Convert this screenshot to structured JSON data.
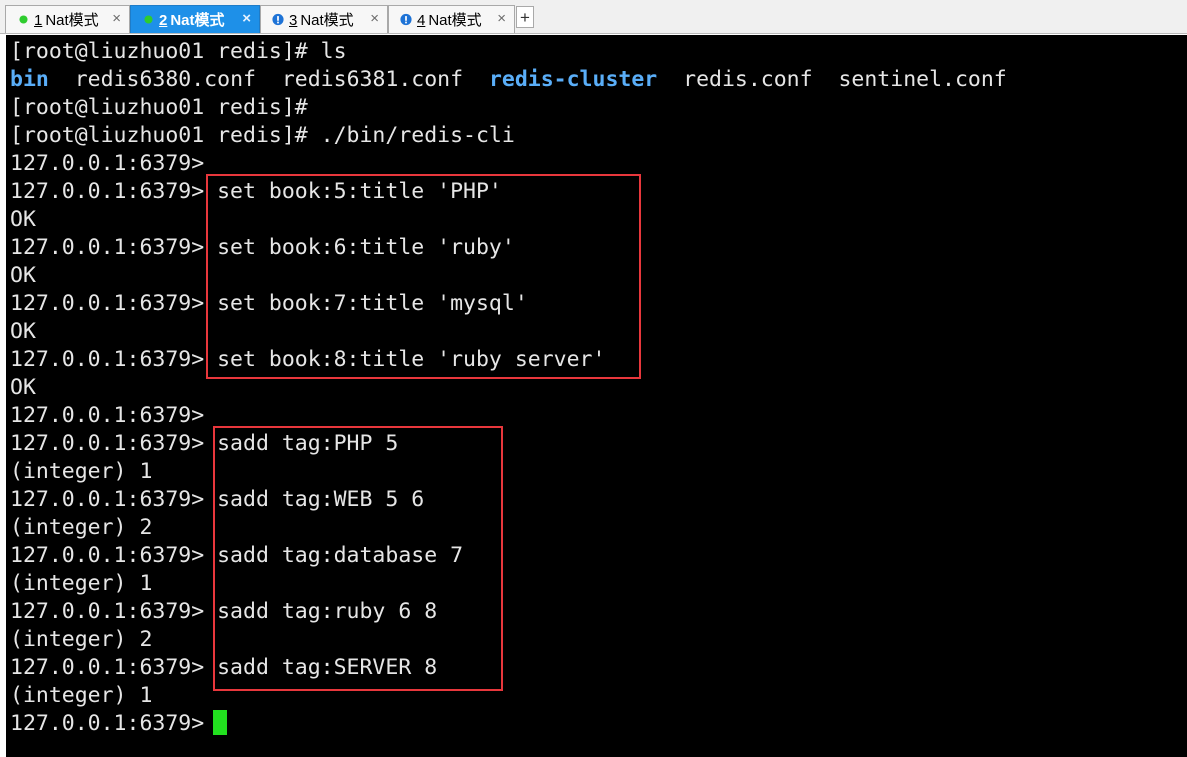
{
  "tabs": [
    {
      "number": "1",
      "name": "Nat模式",
      "status": "connected",
      "status_color": "#2ecc2e",
      "active": false,
      "close": "×"
    },
    {
      "number": "2",
      "name": "Nat模式",
      "status": "connected",
      "status_color": "#2ecc2e",
      "active": true,
      "close": "×"
    },
    {
      "number": "3",
      "name": "Nat模式",
      "status": "warning",
      "status_color": "#1e73d6",
      "active": false,
      "close": "×"
    },
    {
      "number": "4",
      "name": "Nat模式",
      "status": "warning",
      "status_color": "#1e73d6",
      "active": false,
      "close": "×"
    }
  ],
  "new_tab_label": "+",
  "terminal": {
    "prompt_shell": "[root@liuzhuo01 redis]# ",
    "prompt_redis": "127.0.0.1:6379> ",
    "ls_entries": [
      {
        "name": "bin",
        "kind": "dir"
      },
      {
        "name": "redis6380.conf",
        "kind": "file"
      },
      {
        "name": "redis6381.conf",
        "kind": "file"
      },
      {
        "name": "redis-cluster",
        "kind": "dir"
      },
      {
        "name": "redis.conf",
        "kind": "file"
      },
      {
        "name": "sentinel.conf",
        "kind": "file"
      }
    ],
    "lines": [
      {
        "text": "[root@liuzhuo01 redis]# ls"
      },
      {
        "type": "ls"
      },
      {
        "text": "[root@liuzhuo01 redis]#"
      },
      {
        "text": "[root@liuzhuo01 redis]# ./bin/redis-cli"
      },
      {
        "text": "127.0.0.1:6379>"
      },
      {
        "text": "127.0.0.1:6379> set book:5:title 'PHP'"
      },
      {
        "text": "OK"
      },
      {
        "text": "127.0.0.1:6379> set book:6:title 'ruby'"
      },
      {
        "text": "OK"
      },
      {
        "text": "127.0.0.1:6379> set book:7:title 'mysql'"
      },
      {
        "text": "OK"
      },
      {
        "text": "127.0.0.1:6379> set book:8:title 'ruby server'"
      },
      {
        "text": "OK"
      },
      {
        "text": "127.0.0.1:6379>"
      },
      {
        "text": "127.0.0.1:6379> sadd tag:PHP 5"
      },
      {
        "text": "(integer) 1"
      },
      {
        "text": "127.0.0.1:6379> sadd tag:WEB 5 6"
      },
      {
        "text": "(integer) 2"
      },
      {
        "text": "127.0.0.1:6379> sadd tag:database 7"
      },
      {
        "text": "(integer) 1"
      },
      {
        "text": "127.0.0.1:6379> sadd tag:ruby 6 8"
      },
      {
        "text": "(integer) 2"
      },
      {
        "text": "127.0.0.1:6379> sadd tag:SERVER 8"
      },
      {
        "text": "(integer) 1"
      },
      {
        "text": "127.0.0.1:6379>",
        "cursor": true
      }
    ],
    "colors": {
      "background": "#000000",
      "foreground": "#e6e6e6",
      "directory": "#5aaef8",
      "cursor": "#22e01f",
      "highlight_box": "#e8373c"
    }
  }
}
